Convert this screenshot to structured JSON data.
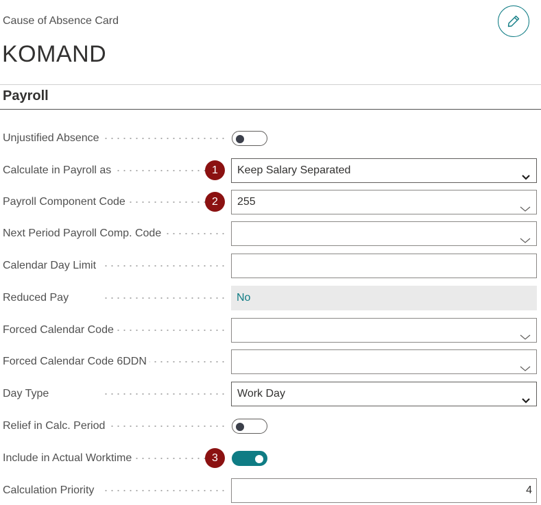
{
  "header": {
    "caption": "Cause of Absence Card",
    "title": "KOMAND",
    "edit_icon": "pencil-icon"
  },
  "section": {
    "title": "Payroll"
  },
  "fields": {
    "unjustified_absence": {
      "label": "Unjustified Absence",
      "value": false
    },
    "calculate_in_payroll": {
      "label": "Calculate in Payroll as",
      "value": "Keep Salary Separated",
      "badge": "1"
    },
    "payroll_component_code": {
      "label": "Payroll Component Code",
      "value": "255",
      "badge": "2"
    },
    "next_period_code": {
      "label": "Next Period Payroll Comp. Code",
      "value": ""
    },
    "calendar_day_limit": {
      "label": "Calendar Day Limit",
      "value": ""
    },
    "reduced_pay": {
      "label": "Reduced Pay",
      "value": "No"
    },
    "forced_calendar_code": {
      "label": "Forced Calendar Code",
      "value": ""
    },
    "forced_calendar_code_6ddn": {
      "label": "Forced Calendar Code 6DDN",
      "value": ""
    },
    "day_type": {
      "label": "Day Type",
      "value": "Work Day"
    },
    "relief_in_calc_period": {
      "label": "Relief in Calc. Period",
      "value": false
    },
    "include_in_actual_worktime": {
      "label": "Include in Actual Worktime",
      "value": true,
      "badge": "3"
    },
    "calculation_priority": {
      "label": "Calculation Priority",
      "value": "4"
    }
  },
  "colors": {
    "accent": "#0f7c84",
    "badge": "#8b1111",
    "readonly_bg": "#eaeaea"
  }
}
